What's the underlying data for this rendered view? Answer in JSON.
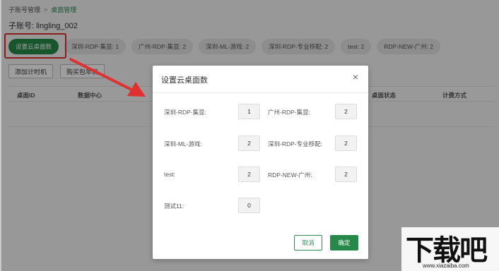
{
  "breadcrumb": {
    "parent": "子账号管理",
    "separator": ">",
    "current": "桌面管理"
  },
  "account": {
    "label": "子账号: lingling_002"
  },
  "chips": [
    {
      "label": "设置云桌面数"
    },
    {
      "label": "深圳-RDP-集显: 1"
    },
    {
      "label": "广州-RDP-集显: 2"
    },
    {
      "label": "深圳-ML-游戏: 2"
    },
    {
      "label": "深圳-RDP-专业移配: 2"
    },
    {
      "label": "test: 2"
    },
    {
      "label": "RDP-NEW-广州: 2"
    }
  ],
  "buttons": {
    "add_timer": "添加计时机",
    "buy_yearly": "购买包年机"
  },
  "table": {
    "columns": [
      "桌面ID",
      "数据中心",
      "桌面状态",
      "计费方式"
    ]
  },
  "modal": {
    "title": "设置云桌面数",
    "fields": [
      {
        "label": "深圳-RDP-集显:",
        "value": "1"
      },
      {
        "label": "广州-RDP-集显:",
        "value": "2"
      },
      {
        "label": "深圳-ML-游戏:",
        "value": "2"
      },
      {
        "label": "深圳-RDP-专业移配:",
        "value": "2"
      },
      {
        "label": "test:",
        "value": "2"
      },
      {
        "label": "RDP-NEW-广州:",
        "value": "2"
      },
      {
        "label": "测试11:",
        "value": "0"
      }
    ],
    "cancel": "取消",
    "confirm": "确定",
    "close_icon": "×"
  },
  "watermark": {
    "text": "下载吧",
    "url": "www.xiazaiba.com"
  },
  "colors": {
    "accent": "#26894a",
    "annotation": "#e03030"
  }
}
